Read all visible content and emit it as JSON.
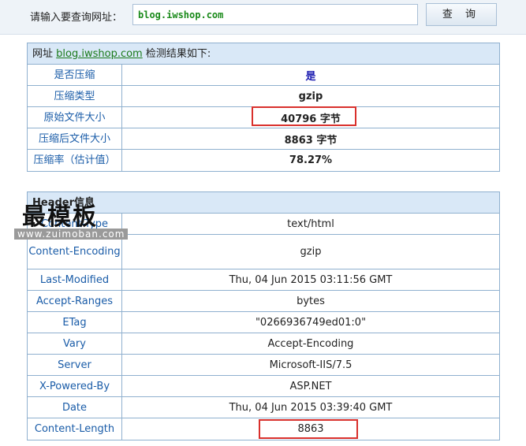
{
  "query": {
    "label": "请输入要查询网址：",
    "url_value": "blog.iwshop.com",
    "button_label": "查 询"
  },
  "result": {
    "head_prefix": "网址",
    "head_link": "blog.iwshop.com",
    "head_suffix": "检测结果如下:",
    "rows": [
      {
        "key": "是否压缩",
        "value": "是"
      },
      {
        "key": "压缩类型",
        "value": "gzip"
      },
      {
        "key": "原始文件大小",
        "value": "40796 字节"
      },
      {
        "key": "压缩后文件大小",
        "value": "8863 字节"
      },
      {
        "key": "压缩率（估计值）",
        "value": "78.27%"
      }
    ]
  },
  "headers": {
    "title": "Header信息",
    "rows": [
      {
        "key": "Content-Type",
        "value": "text/html"
      },
      {
        "key": "Content-Encoding",
        "value": "gzip"
      },
      {
        "key": "Last-Modified",
        "value": "Thu, 04 Jun 2015 03:11:56 GMT"
      },
      {
        "key": "Accept-Ranges",
        "value": "bytes"
      },
      {
        "key": "ETag",
        "value": "\"0266936749ed01:0\""
      },
      {
        "key": "Vary",
        "value": "Accept-Encoding"
      },
      {
        "key": "Server",
        "value": "Microsoft-IIS/7.5"
      },
      {
        "key": "X-Powered-By",
        "value": "ASP.NET"
      },
      {
        "key": "Date",
        "value": "Thu, 04 Jun 2015 03:39:40 GMT"
      },
      {
        "key": "Content-Length",
        "value": "8863"
      }
    ]
  },
  "watermark": {
    "big": "最模板",
    "small": "www.zuimoban.com"
  },
  "colors": {
    "highlight": "#d9302c",
    "link": "#1a7a1a",
    "key_text": "#1a5ca8",
    "header_bg": "#d9e8f7"
  }
}
